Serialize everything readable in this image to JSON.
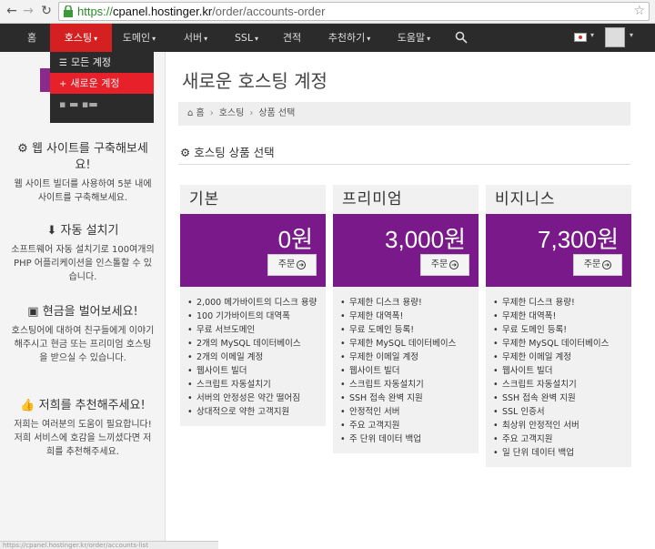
{
  "browser": {
    "url_secure": "https://",
    "url_host": "cpanel.hostinger.kr",
    "url_path": "/order/accounts-order"
  },
  "nav": {
    "home": "홈",
    "hosting": "호스팅",
    "domain": "도메인",
    "server": "서버",
    "ssl": "SSL",
    "quote": "견적",
    "recommend": "추천하기",
    "help": "도움말"
  },
  "dropdown": {
    "all_accounts": "모든 계정",
    "new_account": "새로운 계정"
  },
  "sidebar": {
    "build_title": "웹 사이트를 구축해보세요!",
    "build_text": "웹 사이트 빌더를 사용하여 5분 내에 사이트를 구축해보세요.",
    "auto_title": "자동 설치기",
    "auto_text": "소프트웨어 자동 설치기로 100여개의 PHP 어플리케이션을 인스톨할 수 있습니다.",
    "cash_title": "현금을 벌어보세요!",
    "cash_text": "호스팅어에 대하여 친구들에게 이야기해주시고 현금 또는 프리미엄 호스팅을 받으실 수 있습니다.",
    "rec_title": "저희를 추천해주세요!",
    "rec_text": "저희는 여러분의 도움이 필요합니다! 저희 서비스에 호감을 느끼셨다면 저희를 추천해주세요."
  },
  "main": {
    "title": "새로운 호스팅 계정",
    "breadcrumb": [
      "홈",
      "호스팅",
      "상품 선택"
    ],
    "section_title": "호스팅 상품 선택"
  },
  "plans": [
    {
      "name": "기본",
      "price": "0원",
      "order": "주문",
      "features": [
        "2,000 메가바이트의 디스크 용량",
        "100 기가바이트의 대역폭",
        "무료 서브도메인",
        "2개의 MySQL 데이터베이스",
        "2개의 이메일 계정",
        "웹사이트 빌더",
        "스크립트 자동설치기",
        "서버의 안정성은 약간 떨어짐",
        "상대적으로 약한 고객지원"
      ]
    },
    {
      "name": "프리미엄",
      "price": "3,000원",
      "order": "주문",
      "features": [
        "무제한 디스크 용량!",
        "무제한 대역폭!",
        "무료 도메인 등록!",
        "무제한 MySQL 데이터베이스",
        "무제한 이메일 계정",
        "웹사이트 빌더",
        "스크립트 자동설치기",
        "SSH 접속 완벽 지원",
        "안정적인 서버",
        "주요 고객지원",
        "주 단위 데이터 백업"
      ]
    },
    {
      "name": "비지니스",
      "price": "7,300원",
      "order": "주문",
      "features": [
        "무제한 디스크 용량!",
        "무제한 대역폭!",
        "무료 도메인 등록!",
        "무제한 MySQL 데이터베이스",
        "무제한 이메일 계정",
        "웹사이트 빌더",
        "스크립트 자동설치기",
        "SSH 접속 완벽 지원",
        "SSL 인증서",
        "최상위 안정적인 서버",
        "주요 고객지원",
        "일 단위 데이터 백업"
      ]
    }
  ],
  "status": "https://cpanel.hostinger.kr/order/accounts-list",
  "colors": {
    "nav_bg": "#2b2b2b",
    "accent_red": "#d42020",
    "plan_purple": "#7a1a8a"
  }
}
